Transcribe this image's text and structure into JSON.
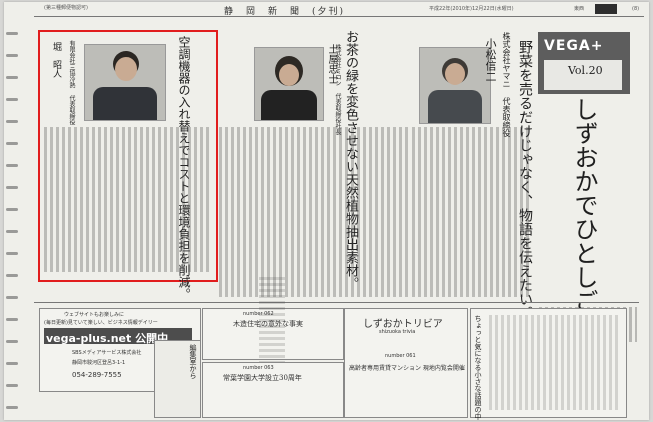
{
  "header": {
    "masthead": "静　岡　新　聞　(夕刊)",
    "date": "平成22年(2010年)12月22日(水曜日)",
    "edition": "東西",
    "weekday": "(8)",
    "top_left_note": "(第三種郵便物認可)"
  },
  "series": {
    "brand": "VEGA+",
    "vol": "Vol.20",
    "title": "しずおかでひとしごと",
    "lead": "野菜を売るだけじゃなく、物語を伝えたい。"
  },
  "articles": [
    {
      "company": "株式会社ヤマニ 代表取締役",
      "name": "小松信二",
      "headline": "野菜を売るだけじゃなく、物語を伝えたい。"
    },
    {
      "company": "株式会社ミロン 代表取締役社長",
      "name": "土屋忠士",
      "headline": "お茶の緑を変色させない天然植物抽出素材。"
    },
    {
      "company": "有限会社三協冷熱 代表取締役",
      "name": "堀　昭人",
      "headline": "空調機器の入れ替えでコストと環境負担を削減。"
    }
  ],
  "vega_box": {
    "tag": "ウェブサイトもお楽しみに",
    "slogan": "(毎日更新)見ていて楽しい、ビジネス情報デイリー",
    "url": "vega-plus.net 公開中",
    "publisher": "SBSメディアサービス株式会社",
    "address": "静岡市駿河区登呂3-1-1",
    "phone": "054-289-7555"
  },
  "mid_box_1": {
    "number": "number 062",
    "title": "木造住宅の意外な事実"
  },
  "mid_box_2": {
    "number": "number 063",
    "title": "常葉学園大学設立30周年"
  },
  "trivia_box": {
    "title": "しずおかトリビア",
    "subtitle": "shizuoka trivia",
    "number": "number 061",
    "headline": "高齢者専用賃貸マンション 現地内覧会開催"
  },
  "ad": {
    "vertical": "ちょっと気になる小さな話題の中から"
  },
  "column": {
    "label": "編集室から"
  }
}
